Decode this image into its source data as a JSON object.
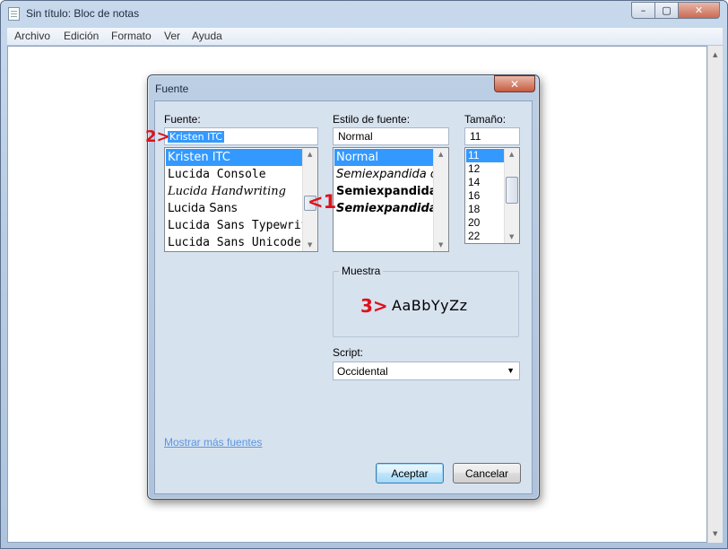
{
  "window": {
    "title": "Sin título: Bloc de notas",
    "menu": [
      "Archivo",
      "Edición",
      "Formato",
      "Ver",
      "Ayuda"
    ]
  },
  "dialog": {
    "title": "Fuente",
    "font": {
      "label": "Fuente:",
      "value": "Kristen ITC",
      "items": [
        "Kristen ITC",
        "Lucida Console",
        "Lucida Handwriting",
        "Lucida Sans",
        "Lucida Sans Typewriter",
        "Lucida Sans Unicode"
      ],
      "selected_index": 0
    },
    "style": {
      "label": "Estilo de fuente:",
      "value": "Normal",
      "items": [
        "Normal",
        "Semiexpandida cursiva",
        "Semiexpandida negrita",
        "Semiexpandida negrita cursiva"
      ],
      "selected_index": 0
    },
    "size": {
      "label": "Tamaño:",
      "value": "11",
      "items": [
        "11",
        "12",
        "14",
        "16",
        "18",
        "20",
        "22"
      ],
      "selected_index": 0
    },
    "sample": {
      "legend": "Muestra",
      "text": "AaBbYyZz"
    },
    "script": {
      "label": "Script:",
      "value": "Occidental"
    },
    "more_fonts_link": "Mostrar más fuentes",
    "ok_button": "Aceptar",
    "cancel_button": "Cancelar"
  },
  "annotations": {
    "marker_1": "<1",
    "marker_2": "2>",
    "marker_3": "3>",
    "color": "#e0101a"
  },
  "colors": {
    "selection": "#3399ff",
    "link": "#5a96e0"
  }
}
